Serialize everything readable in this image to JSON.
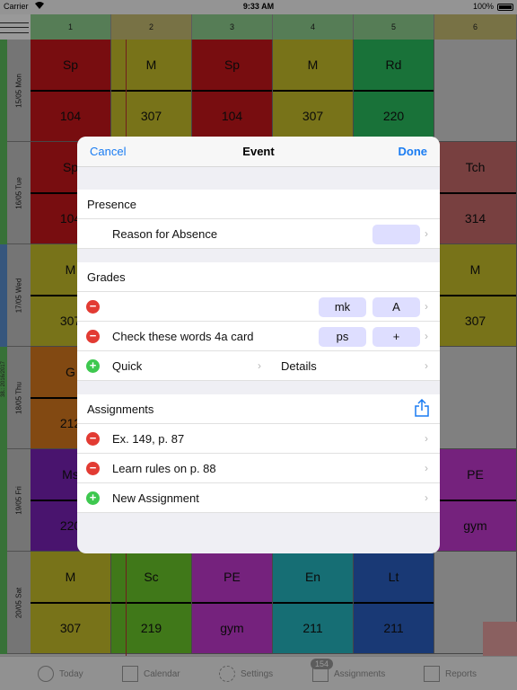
{
  "status_bar": {
    "carrier": "Carrier",
    "time": "9:33 AM",
    "battery": "100%"
  },
  "columns": [
    "1",
    "2",
    "3",
    "4",
    "5",
    "6"
  ],
  "week_label": "38.: 2016/2017",
  "days": [
    {
      "date": "15/05",
      "day": "Mon",
      "color": "#5cbd5c"
    },
    {
      "date": "16/05",
      "day": "Tue",
      "color": "#5cbd5c"
    },
    {
      "date": "17/05",
      "day": "Wed",
      "color": "#5b8fd0"
    },
    {
      "date": "18/05",
      "day": "Thu",
      "color": "#5cbd5c"
    },
    {
      "date": "19/05",
      "day": "Fri",
      "color": "#5cbd5c"
    },
    {
      "date": "20/05",
      "day": "Sat",
      "color": "#5cbd5c"
    }
  ],
  "cells": [
    [
      {
        "s": "Sp",
        "r": "104",
        "c": "#c8161b"
      },
      {
        "s": "M",
        "r": "307",
        "c": "#c8c02a"
      },
      {
        "s": "Sp",
        "r": "104",
        "c": "#c8161b"
      },
      {
        "s": "M",
        "r": "307",
        "c": "#c8c02a"
      },
      {
        "s": "Rd",
        "r": "220",
        "c": "#2bbf5f"
      },
      null
    ],
    [
      {
        "s": "Sp",
        "r": "104",
        "c": "#c8161b"
      },
      null,
      null,
      null,
      null,
      {
        "s": "Tch",
        "r": "314",
        "c": "#c96b6b"
      }
    ],
    [
      {
        "s": "M",
        "r": "307",
        "c": "#c8c02a"
      },
      null,
      null,
      null,
      null,
      {
        "s": "M",
        "r": "307",
        "c": "#c8c02a"
      }
    ],
    [
      {
        "s": "G",
        "r": "212",
        "c": "#d97a1f"
      },
      null,
      null,
      null,
      null,
      null
    ],
    [
      {
        "s": "Ms",
        "r": "220",
        "c": "#7a22b8"
      },
      null,
      null,
      null,
      null,
      {
        "s": "PE",
        "r": "gym",
        "c": "#c43ad0"
      }
    ],
    [
      {
        "s": "M",
        "r": "307",
        "c": "#c8c02a"
      },
      {
        "s": "Sc",
        "r": "219",
        "c": "#6cc92a"
      },
      {
        "s": "PE",
        "r": "gym",
        "c": "#c43ad0"
      },
      {
        "s": "En",
        "r": "211",
        "c": "#25b8c2"
      },
      {
        "s": "Lt",
        "r": "211",
        "c": "#2a5fc4"
      },
      null
    ]
  ],
  "tabs": [
    {
      "label": "Today",
      "icon": "clock-icon"
    },
    {
      "label": "Calendar",
      "icon": "calendar-icon"
    },
    {
      "label": "Settings",
      "icon": "gear-icon"
    },
    {
      "label": "Assignments",
      "icon": "assignments-icon",
      "badge": "154"
    },
    {
      "label": "Reports",
      "icon": "report-icon"
    }
  ],
  "modal": {
    "cancel": "Cancel",
    "title": "Event",
    "done": "Done",
    "presence": {
      "header": "Presence",
      "reason_label": "Reason for Absence",
      "reason_value": ""
    },
    "grades": {
      "header": "Grades",
      "rows": [
        {
          "label": "",
          "type": "mk",
          "grade": "A"
        },
        {
          "label": "Check these words 4a card",
          "type": "ps",
          "grade": "+"
        }
      ],
      "quick": "Quick",
      "details": "Details"
    },
    "assignments": {
      "header": "Assignments",
      "items": [
        "Ex. 149, p. 87",
        "Learn rules on p. 88"
      ],
      "new": "New Assignment"
    }
  },
  "colors": {
    "accent": "#1a7cf2",
    "delete": "#e23b33",
    "add": "#3ec84f",
    "pill": "#dedeff"
  }
}
